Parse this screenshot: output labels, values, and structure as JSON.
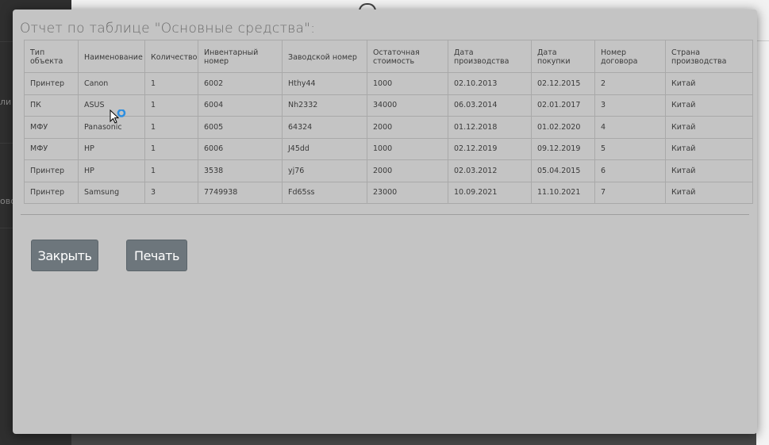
{
  "background": {
    "sidebar_texts": [
      "ли",
      "ово"
    ]
  },
  "modal": {
    "title": "Отчет по таблице \"Основные средства\":",
    "table": {
      "headers": [
        "Тип объекта",
        "Наименование",
        "Количество",
        "Инвентарный номер",
        "Заводской номер",
        "Остаточная стоимость",
        "Дата производства",
        "Дата покупки",
        "Номер договора",
        "Страна производства"
      ],
      "rows": [
        [
          "Принтер",
          "Canon",
          "1",
          "6002",
          "Hthy44",
          "1000",
          "02.10.2013",
          "02.12.2015",
          "2",
          "Китай"
        ],
        [
          "ПК",
          "ASUS",
          "1",
          "6004",
          "Nh2332",
          "34000",
          "06.03.2014",
          "02.01.2017",
          "3",
          "Китай"
        ],
        [
          "МФУ",
          "Panasonic",
          "1",
          "6005",
          "64324",
          "2000",
          "01.12.2018",
          "01.02.2020",
          "4",
          "Китай"
        ],
        [
          "МФУ",
          "HP",
          "1",
          "6006",
          "J45dd",
          "1000",
          "02.12.2019",
          "09.12.2019",
          "5",
          "Китай"
        ],
        [
          "Принтер",
          "HP",
          "1",
          "3538",
          "yj76",
          "2000",
          "02.03.2012",
          "05.04.2015",
          "6",
          "Китай"
        ],
        [
          "Принтер",
          "Samsung",
          "3",
          "7749938",
          "Fd65ss",
          "23000",
          "10.09.2021",
          "11.10.2021",
          "7",
          "Китай"
        ]
      ]
    },
    "buttons": {
      "close": "Закрыть",
      "print": "Печать"
    }
  },
  "colors": {
    "modal_bg": "#c4c4c4",
    "button_bg": "#6d767c",
    "cursor_ring": "#2f8fe0"
  }
}
